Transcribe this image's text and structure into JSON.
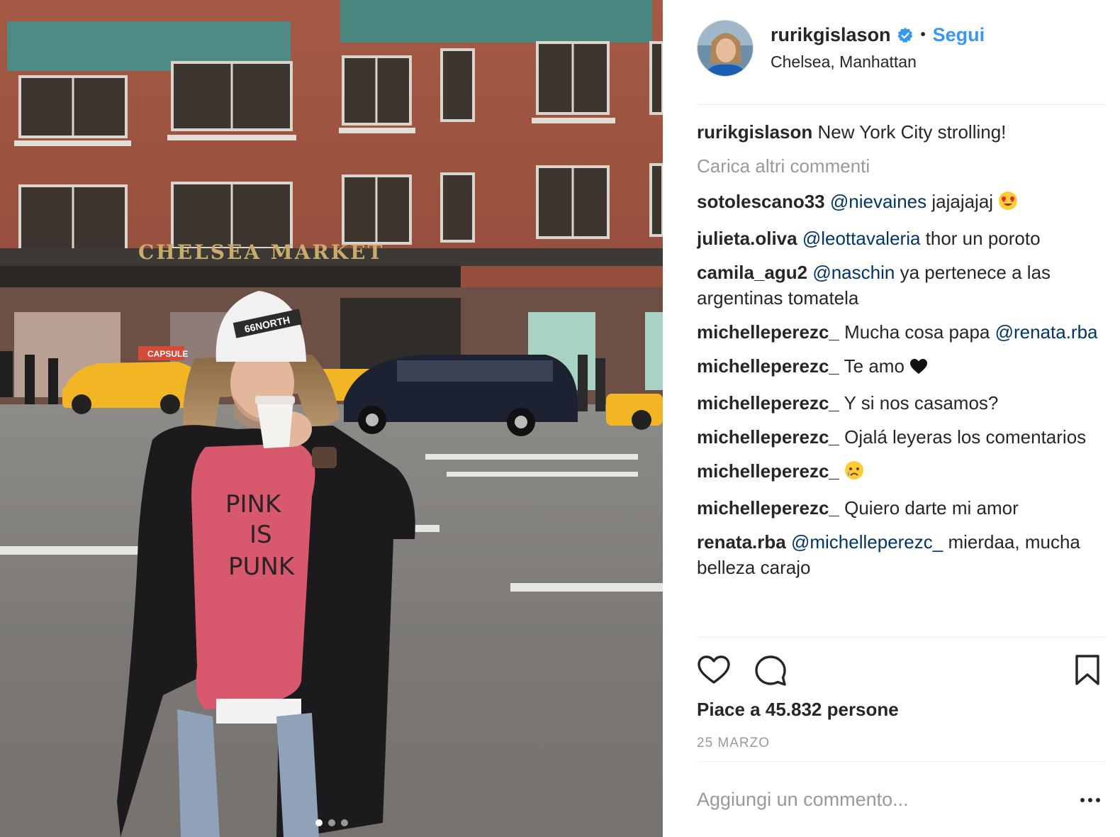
{
  "post": {
    "author": "rurikgislason",
    "follow_label": "Segui",
    "separator": "•",
    "location": "Chelsea, Manhattan",
    "caption_user": "rurikgislason",
    "caption_text": "New York City strolling!",
    "load_more": "Carica altri commenti",
    "likes": "Piace a 45.832 persone",
    "date": "25 MARZO",
    "comment_placeholder": "Aggiungi un commento...",
    "carousel": {
      "count": 3,
      "active": 1
    }
  },
  "photo": {
    "sign_text": "CHELSEA MARKET",
    "sign_small": "CHELSEA",
    "shop_sign": "CAPSULE",
    "shirt_lines": [
      "PINK",
      "IS",
      "PUNK"
    ],
    "beanie_text": "66NORTH"
  },
  "comments": [
    {
      "user": "sotolescano33",
      "mention": "@nievaines",
      "text": " jajajajaj ",
      "emoji": "heart-eyes"
    },
    {
      "user": "julieta.oliva",
      "mention": "@leottavaleria",
      "text": " thor un poroto"
    },
    {
      "user": "camila_agu2",
      "mention": "@naschin",
      "text": " ya pertenece a las argentinas tomatela"
    },
    {
      "user": "michelleperezc_",
      "text": " Mucha cosa papa ",
      "mention_after": "@renata.rba"
    },
    {
      "user": "michelleperezc_",
      "text": " Te amo ",
      "emoji": "heart"
    },
    {
      "user": "michelleperezc_",
      "text": " Y si nos casamos?"
    },
    {
      "user": "michelleperezc_",
      "text": " Ojalá leyeras los comentarios"
    },
    {
      "user": "michelleperezc_",
      "text": " ",
      "emoji": "crying-face"
    },
    {
      "user": "michelleperezc_",
      "text": " Quiero darte mi amor"
    },
    {
      "user": "renata.rba",
      "mention": "@michelleperezc_",
      "text": " mierdaa, mucha belleza carajo"
    }
  ],
  "icons": {
    "like": "heart-outline-icon",
    "comment": "speech-bubble-icon",
    "save": "bookmark-icon",
    "more": "ellipsis-icon",
    "verified": "verified-badge-icon"
  },
  "colors": {
    "follow": "#3897f0",
    "mention": "#003569",
    "muted": "#999999",
    "text": "#262626",
    "verified": "#3897f0"
  }
}
